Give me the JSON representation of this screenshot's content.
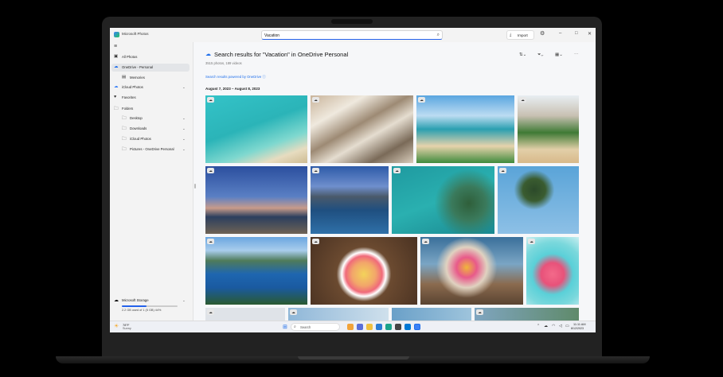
{
  "window": {
    "app_title": "Microsoft Photos",
    "search_value": "Vacation",
    "import_label": "Import"
  },
  "sidebar": {
    "items": [
      {
        "label": "All Photos",
        "icon": "photos-icon"
      },
      {
        "label": "OneDrive - Personal",
        "icon": "cloud-icon",
        "selected": true
      },
      {
        "label": "Memories",
        "icon": "memories-icon"
      },
      {
        "label": "iCloud Photos",
        "icon": "icloud-icon"
      },
      {
        "label": "Favorites",
        "icon": "heart-icon"
      },
      {
        "label": "Folders",
        "icon": "folder-icon"
      },
      {
        "label": "Desktop",
        "icon": "folder-icon"
      },
      {
        "label": "Downloads",
        "icon": "folder-icon"
      },
      {
        "label": "iCloud Photos",
        "icon": "folder-icon"
      },
      {
        "label": "Pictures - OneDrive Personal",
        "icon": "folder-icon"
      }
    ],
    "storage": {
      "label": "Microsoft Storage",
      "usage_text": "2.2 GB used of 1 (5 GB) 44%",
      "fraction_used": 0.44
    }
  },
  "content": {
    "title": "Search results for \"Vacation\" in OneDrive Personal",
    "subtitle": "3515 photos, 189 videos",
    "powered_by": "Search results powered by OneDrive ⓘ",
    "date_range": "August 7, 2023 – August 8, 2023"
  },
  "taskbar": {
    "weather_temp": "78°F",
    "weather_desc": "Sunny",
    "search_label": "Search",
    "time": "11:11 AM",
    "date": "8/12/2023"
  },
  "colors": {
    "accent": "#1f6feb",
    "sidebar_bg": "#f3f3f3",
    "content_bg": "#f6f7f9"
  }
}
